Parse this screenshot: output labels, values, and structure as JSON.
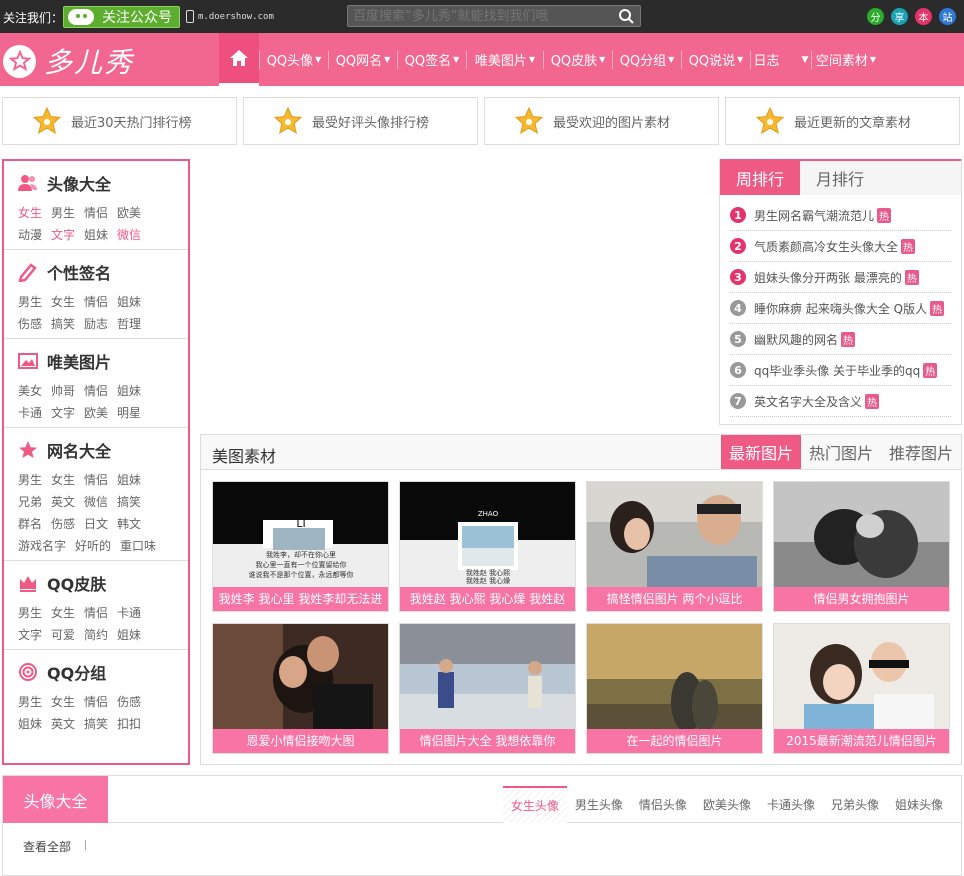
{
  "topbar": {
    "follow_label": "关注我们：",
    "wechat_button": "关注公众号",
    "mobile_site": "m.doershow.com",
    "search_placeholder": "百度搜索“多儿秀”就能找到我们哦",
    "socials": [
      {
        "label": "分",
        "color": "#2bab2b"
      },
      {
        "label": "享",
        "color": "#1aa3b5"
      },
      {
        "label": "本",
        "color": "#e4346a"
      },
      {
        "label": "站",
        "color": "#2f78d6"
      }
    ]
  },
  "header": {
    "logo_text": "多儿秀",
    "nav": [
      "QQ头像",
      "QQ网名",
      "QQ签名",
      "唯美图片",
      "QQ皮肤",
      "QQ分组",
      "QQ说说",
      "日志",
      "空间素材"
    ]
  },
  "quick_links": [
    "最近30天热门排行榜",
    "最受好评头像排行榜",
    "最受欢迎的图片素材",
    "最近更新的文章素材"
  ],
  "sidebar": [
    {
      "title": "头像大全",
      "icon": "users-icon",
      "links": [
        {
          "t": "女生",
          "pink": true
        },
        {
          "t": "男生"
        },
        {
          "t": "情侣"
        },
        {
          "t": "欧美"
        },
        {
          "t": "动漫"
        },
        {
          "t": "文字",
          "pink": true
        },
        {
          "t": "姐妹"
        },
        {
          "t": "微信",
          "pink": true
        }
      ]
    },
    {
      "title": "个性签名",
      "icon": "pencil-icon",
      "links": [
        {
          "t": "男生"
        },
        {
          "t": "女生"
        },
        {
          "t": "情侣"
        },
        {
          "t": "姐妹"
        },
        {
          "t": "伤感"
        },
        {
          "t": "搞笑"
        },
        {
          "t": "励志"
        },
        {
          "t": "哲理"
        }
      ]
    },
    {
      "title": "唯美图片",
      "icon": "picture-icon",
      "links": [
        {
          "t": "美女"
        },
        {
          "t": "帅哥"
        },
        {
          "t": "情侣"
        },
        {
          "t": "姐妹"
        },
        {
          "t": "卡通"
        },
        {
          "t": "文字"
        },
        {
          "t": "欧美"
        },
        {
          "t": "明星"
        }
      ]
    },
    {
      "title": "网名大全",
      "icon": "star-icon",
      "links": [
        {
          "t": "男生"
        },
        {
          "t": "女生"
        },
        {
          "t": "情侣"
        },
        {
          "t": "姐妹"
        },
        {
          "t": "兄弟"
        },
        {
          "t": "英文"
        },
        {
          "t": "微信"
        },
        {
          "t": "搞笑"
        },
        {
          "t": "群名"
        },
        {
          "t": "伤感"
        },
        {
          "t": "日文"
        },
        {
          "t": "韩文"
        },
        {
          "t": "游戏名字"
        },
        {
          "t": "好听的"
        },
        {
          "t": "重口味"
        }
      ]
    },
    {
      "title": "QQ皮肤",
      "icon": "crown-icon",
      "links": [
        {
          "t": "男生"
        },
        {
          "t": "女生"
        },
        {
          "t": "情侣"
        },
        {
          "t": "卡通"
        },
        {
          "t": "文字"
        },
        {
          "t": "可爱"
        },
        {
          "t": "简约"
        },
        {
          "t": "姐妹"
        }
      ]
    },
    {
      "title": "QQ分组",
      "icon": "target-icon",
      "links": [
        {
          "t": "男生"
        },
        {
          "t": "女生"
        },
        {
          "t": "情侣"
        },
        {
          "t": "伤感"
        },
        {
          "t": "姐妹"
        },
        {
          "t": "英文"
        },
        {
          "t": "搞笑"
        },
        {
          "t": "扣扣"
        }
      ]
    }
  ],
  "ranking": {
    "tabs": [
      "周排行",
      "月排行"
    ],
    "hot_badge": "热",
    "items": [
      {
        "n": "1",
        "text": "男生网名霸气潮流范儿"
      },
      {
        "n": "2",
        "text": "气质素颜高冷女生头像大全"
      },
      {
        "n": "3",
        "text": "姐妹头像分开两张 最漂亮的"
      },
      {
        "n": "4",
        "text": "睡你麻痹 起来嗨头像大全 Q版人"
      },
      {
        "n": "5",
        "text": "幽默风趣的网名"
      },
      {
        "n": "6",
        "text": "qq毕业季头像 关于毕业季的qq"
      },
      {
        "n": "7",
        "text": "英文名字大全及含义"
      }
    ],
    "colors": {
      "top": "#e4346a",
      "rest": "#999999"
    }
  },
  "gallery": {
    "title": "美图素材",
    "tabs": [
      "最新图片",
      "热门图片",
      "推荐图片"
    ],
    "items": [
      {
        "caption": "我姓李 我心里 我姓李却无法进",
        "label": "LI",
        "lines": [
          "我姓李，却不在你心里",
          "我心里一直有一个位置留给你",
          "谁说我不是那个位置，永远都等你"
        ]
      },
      {
        "caption": "我姓赵 我心熙 我心燥 我姓赵",
        "label": "ZHAO",
        "lines": [
          "我姓赵  我心熙",
          "我姓赵 我心燥"
        ]
      },
      {
        "caption": "搞怪情侣图片 两个小逗比"
      },
      {
        "caption": "情侣男女拥抱图片"
      },
      {
        "caption": "恩爱小情侣接吻大图"
      },
      {
        "caption": "情侣图片大全 我想依靠你"
      },
      {
        "caption": "在一起的情侣图片"
      },
      {
        "caption": "2015最新潮流范儿情侣图片"
      }
    ]
  },
  "bottom": {
    "title": "头像大全",
    "tabs": [
      "女生头像",
      "男生头像",
      "情侣头像",
      "欧美头像",
      "卡通头像",
      "兄弟头像",
      "姐妹头像"
    ],
    "view_all": "查看全部"
  },
  "colors": {
    "brand": "#f2678f",
    "accent": "#ef5a85",
    "caption": "#f774a5",
    "topbar": "#2b2b2b"
  }
}
